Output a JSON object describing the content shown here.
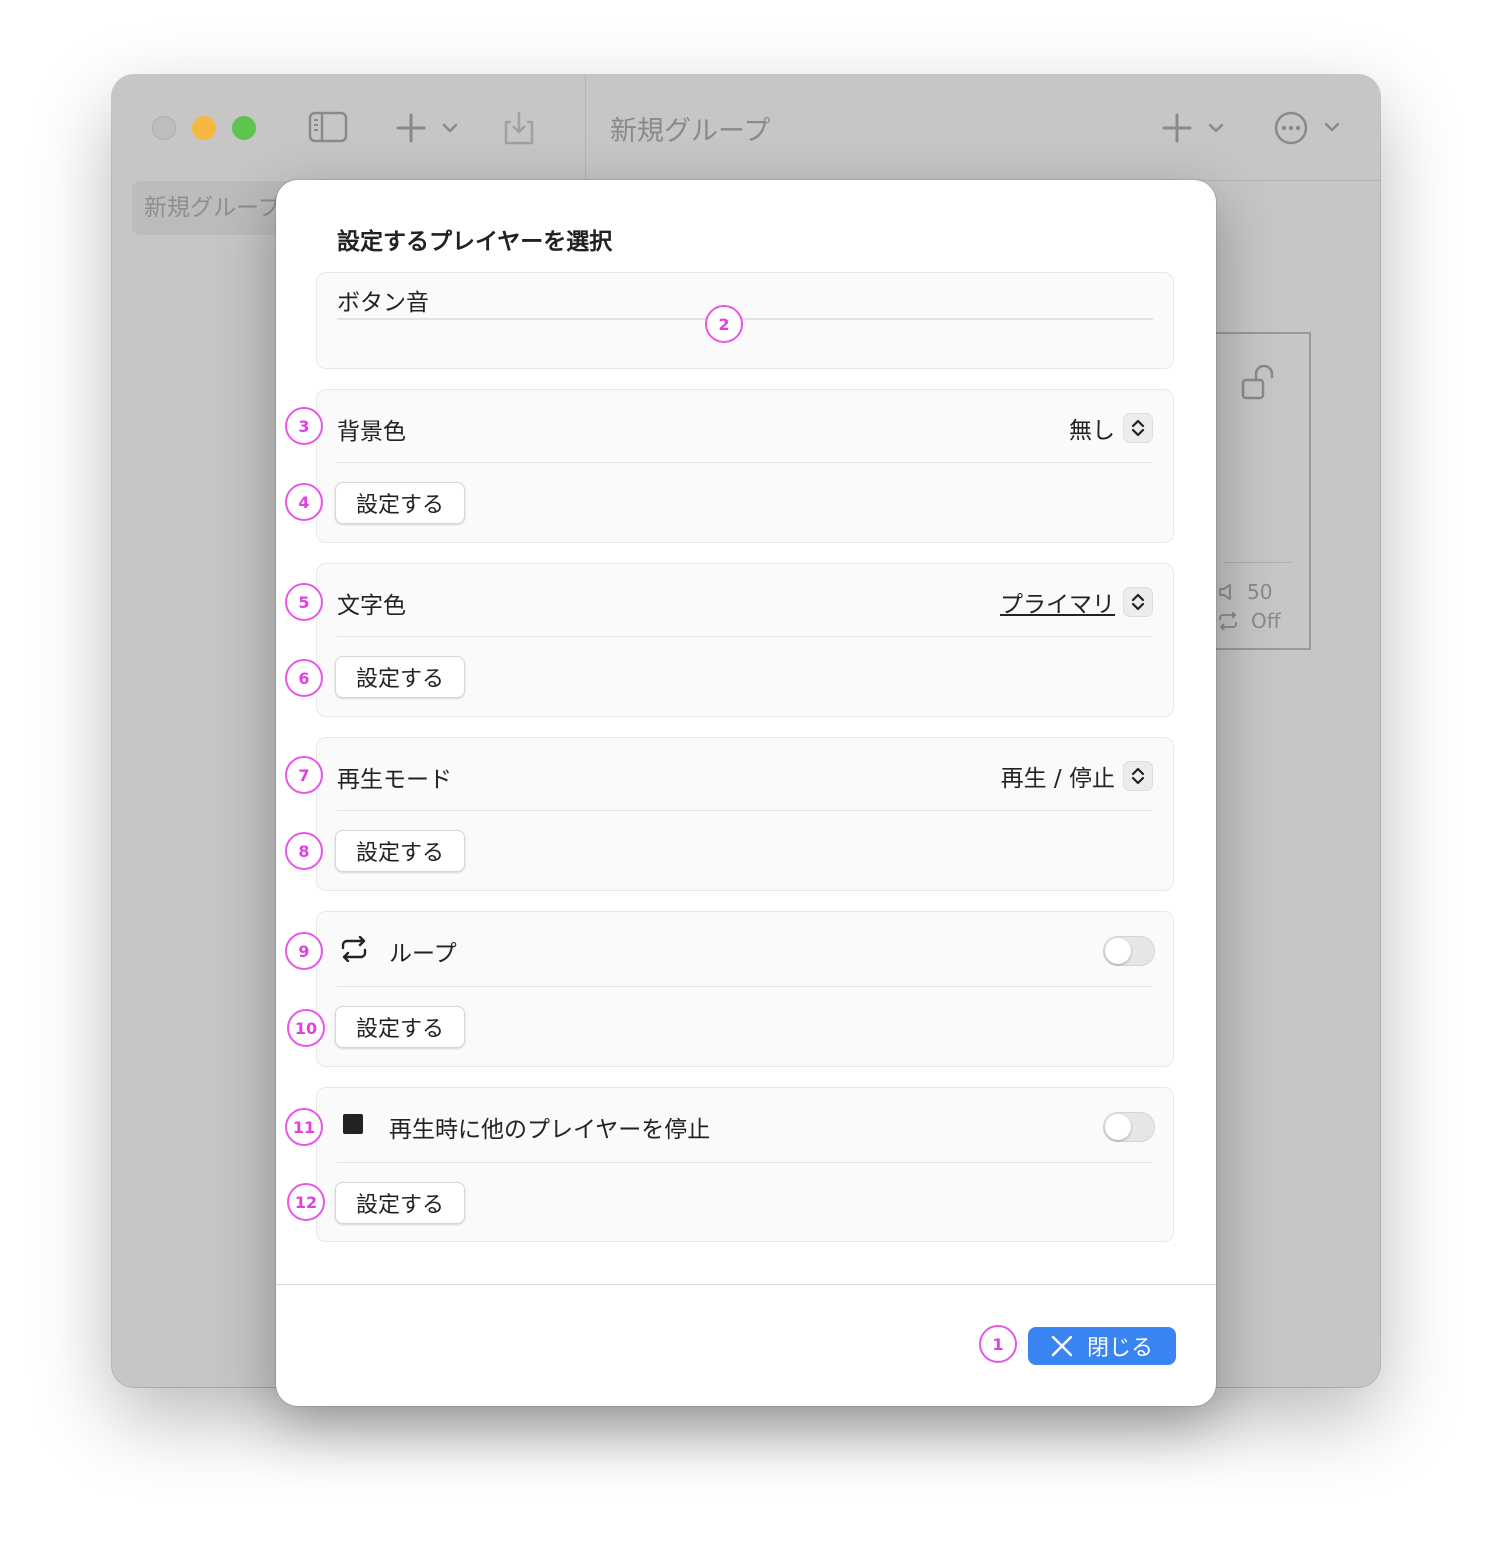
{
  "window": {
    "title": "新規グループ",
    "sidebar_item": "新規グループ",
    "player_card": {
      "volume": "50",
      "loop": "Off"
    }
  },
  "dialog": {
    "title": "設定するプレイヤーを選択",
    "sections": {
      "sound": {
        "label": "ボタン音",
        "badge": "2"
      },
      "background": {
        "label": "背景色",
        "value": "無し",
        "button": "設定する",
        "badge_row": "3",
        "badge_btn": "4"
      },
      "text_color": {
        "label": "文字色",
        "value": "プライマリ",
        "button": "設定する",
        "badge_row": "5",
        "badge_btn": "6"
      },
      "play_mode": {
        "label": "再生モード",
        "value": "再生 / 停止",
        "button": "設定する",
        "badge_row": "7",
        "badge_btn": "8"
      },
      "loop": {
        "label": "ループ",
        "on": false,
        "button": "設定する",
        "badge_row": "9",
        "badge_btn": "10"
      },
      "stop_others": {
        "label": "再生時に他のプレイヤーを停止",
        "on": false,
        "button": "設定する",
        "badge_row": "11",
        "badge_btn": "12"
      }
    },
    "close_button": "閉じる",
    "close_badge": "1"
  },
  "colors": {
    "accent": "#3a84f2",
    "badge": "#e040e0"
  }
}
